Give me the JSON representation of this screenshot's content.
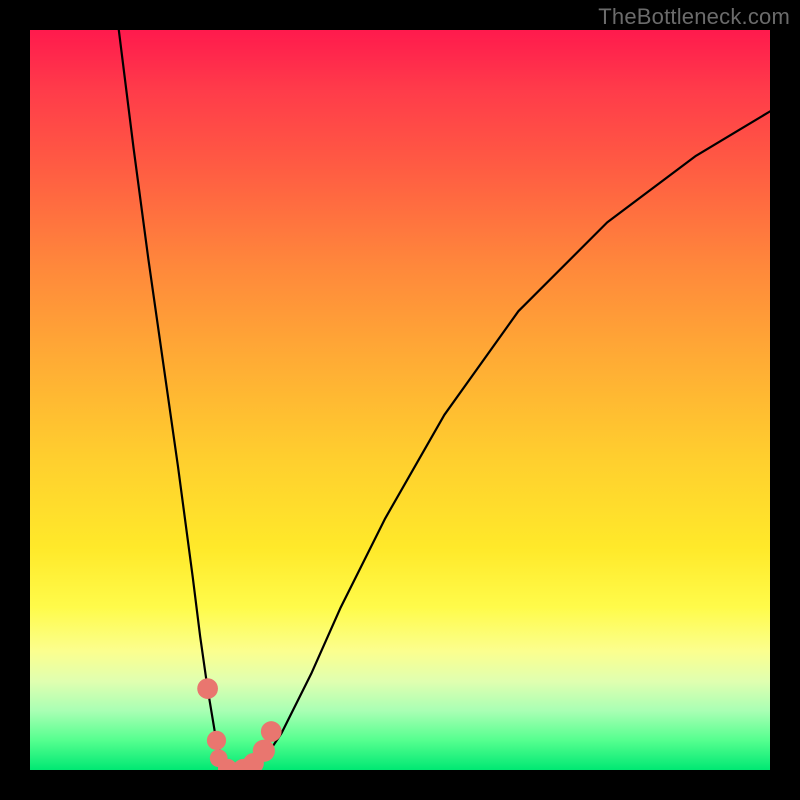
{
  "watermark": "TheBottleneck.com",
  "chart_data": {
    "type": "line",
    "title": "",
    "xlabel": "",
    "ylabel": "",
    "xlim": [
      0,
      100
    ],
    "ylim": [
      0,
      100
    ],
    "series": [
      {
        "name": "curve",
        "x": [
          12,
          14,
          16,
          18,
          20,
          22,
          23,
          24,
          25,
          26,
          27,
          28,
          30,
          32,
          34,
          38,
          42,
          48,
          56,
          66,
          78,
          90,
          100
        ],
        "values": [
          100,
          84,
          69,
          55,
          41,
          26,
          18,
          11,
          5,
          1,
          0,
          0,
          0.5,
          2,
          5,
          13,
          22,
          34,
          48,
          62,
          74,
          83,
          89
        ]
      }
    ],
    "markers": [
      {
        "x": 24.0,
        "y": 11.0,
        "r": 1.4
      },
      {
        "x": 25.2,
        "y": 4.0,
        "r": 1.3
      },
      {
        "x": 25.5,
        "y": 1.6,
        "r": 1.2
      },
      {
        "x": 26.7,
        "y": 0.2,
        "r": 1.3
      },
      {
        "x": 28.8,
        "y": 0.1,
        "r": 1.4
      },
      {
        "x": 30.2,
        "y": 0.9,
        "r": 1.4
      },
      {
        "x": 31.6,
        "y": 2.6,
        "r": 1.5
      },
      {
        "x": 32.6,
        "y": 5.2,
        "r": 1.4
      }
    ],
    "marker_color": "#e9766f",
    "curve_color": "#000000"
  }
}
